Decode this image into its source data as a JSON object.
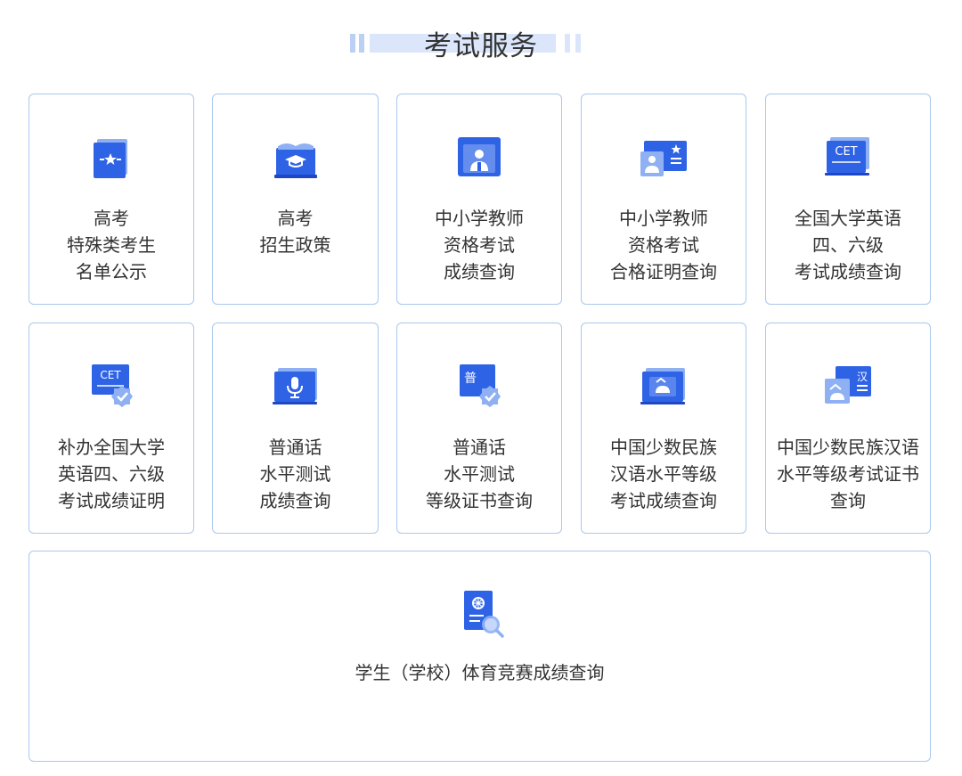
{
  "header": {
    "title": "考试服务"
  },
  "colors": {
    "accent": "#2f63e6",
    "accent_light": "#8fb0f3",
    "card_border": "#aac8ec",
    "text": "#333333"
  },
  "cards": [
    {
      "label": "高考\n特殊类考生\n名单公示",
      "icon": "star-badge-icon"
    },
    {
      "label": "高考\n招生政策",
      "icon": "graduation-book-icon"
    },
    {
      "label": "中小学教师\n资格考试\n成绩查询",
      "icon": "teacher-id-icon"
    },
    {
      "label": "中小学教师\n资格考试\n合格证明查询",
      "icon": "certificate-id-icon"
    },
    {
      "label": "全国大学英语\n四、六级\n考试成绩查询",
      "icon": "cet-icon"
    },
    {
      "label": "补办全国大学\n英语四、六级\n考试成绩证明",
      "icon": "cet-verified-icon"
    },
    {
      "label": "普通话\n水平测试\n成绩查询",
      "icon": "microphone-icon"
    },
    {
      "label": "普通话\n水平测试\n等级证书查询",
      "icon": "mandarin-verified-icon"
    },
    {
      "label": "中国少数民族\n汉语水平等级\n考试成绩查询",
      "icon": "minority-exam-icon"
    },
    {
      "label": "中国少数民族汉语\n水平等级考试证书\n查询",
      "icon": "hanyu-certificate-icon"
    }
  ],
  "wide_card": {
    "label": "学生（学校）体育竞赛成绩查询",
    "icon": "sports-search-icon",
    "icon_text": {
      "cet": "CET",
      "mandarin": "普",
      "hanzi": "汉"
    }
  }
}
